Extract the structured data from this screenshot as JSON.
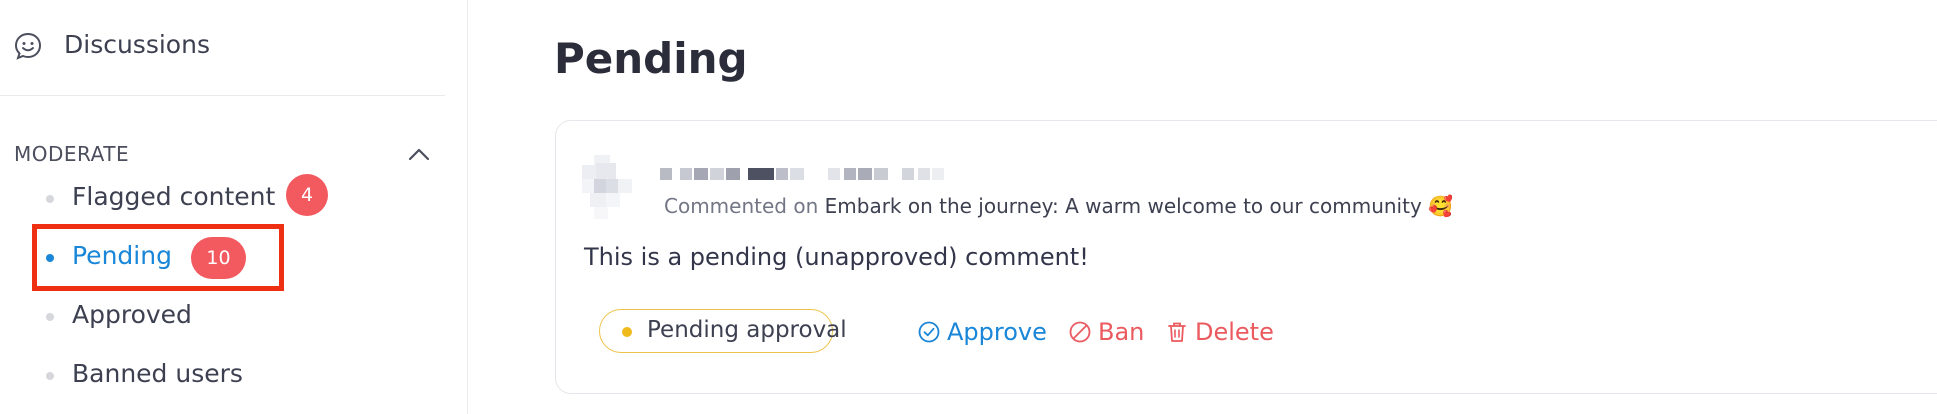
{
  "sidebar": {
    "discussions_label": "Discussions",
    "section_title": "MODERATE",
    "items": [
      {
        "label": "Flagged content",
        "badge": "4"
      },
      {
        "label": "Pending",
        "badge": "10"
      },
      {
        "label": "Approved"
      },
      {
        "label": "Banned users"
      }
    ]
  },
  "main": {
    "title": "Pending",
    "card": {
      "meta_prefix": "Commented on",
      "post_title": "Embark on the journey: A warm welcome to our community",
      "emoji": "🥰",
      "comment_text": "This is a pending (unapproved) comment!",
      "status_label": "Pending approval",
      "actions": {
        "approve": "Approve",
        "ban": "Ban",
        "delete": "Delete"
      }
    }
  },
  "colors": {
    "accent": "#1a86d8",
    "danger": "#ea5a5f",
    "badge": "#f25a5f",
    "pending": "#efba1b",
    "highlight": "#ee2f12"
  },
  "icons": {
    "discussions": "smiley-chat-icon",
    "collapse": "chevron-up-icon",
    "approve": "check-circle-icon",
    "ban": "ban-icon",
    "delete": "trash-icon"
  }
}
